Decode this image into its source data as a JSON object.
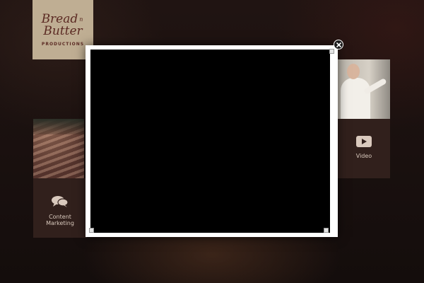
{
  "logo": {
    "line1": "Bread",
    "connector": "n",
    "line2": "Butter",
    "subtitle": "PRODUCTIONS"
  },
  "tiles": {
    "content_marketing": {
      "icon": "chat-bubbles-icon",
      "label_line1": "Content",
      "label_line2": "Marketing"
    },
    "video": {
      "icon": "play-icon",
      "label": "Video"
    }
  },
  "modal": {
    "close_icon": "close-icon",
    "player_color": "#000000",
    "frame_color": "#ffffff"
  },
  "colors": {
    "tile_background": "#31201c",
    "logo_background": "#bfae93",
    "logo_text": "#5b2a23"
  }
}
